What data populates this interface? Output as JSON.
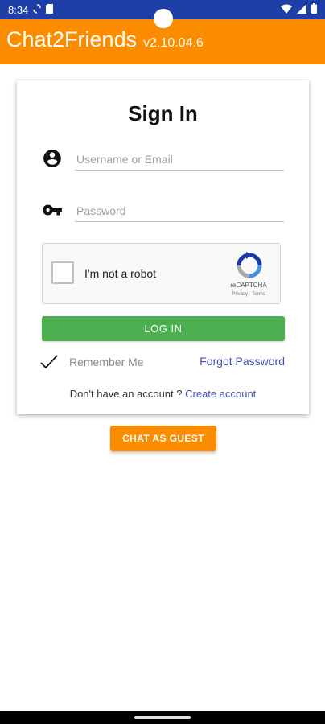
{
  "status_bar": {
    "time": "8:34",
    "icons": [
      "sync-icon",
      "sim-card-icon",
      "wifi-icon",
      "signal-icon",
      "battery-icon"
    ]
  },
  "app_bar": {
    "title": "Chat2Friends",
    "version": "v2.10.04.6",
    "color": "#fb8c00"
  },
  "signin": {
    "title": "Sign In",
    "username_placeholder": "Username or Email",
    "password_placeholder": "Password",
    "recaptcha": {
      "label": "I'm not a robot",
      "brand": "reCAPTCHA",
      "links": "Privacy - Terms"
    },
    "login_label": "LOG IN",
    "login_color": "#4caf50",
    "remember_label": "Remember Me",
    "forgot_label": "Forgot Password",
    "account_prompt": "Don't have an account ?",
    "create_label": "Create account"
  },
  "guest": {
    "label": "CHAT AS GUEST"
  }
}
